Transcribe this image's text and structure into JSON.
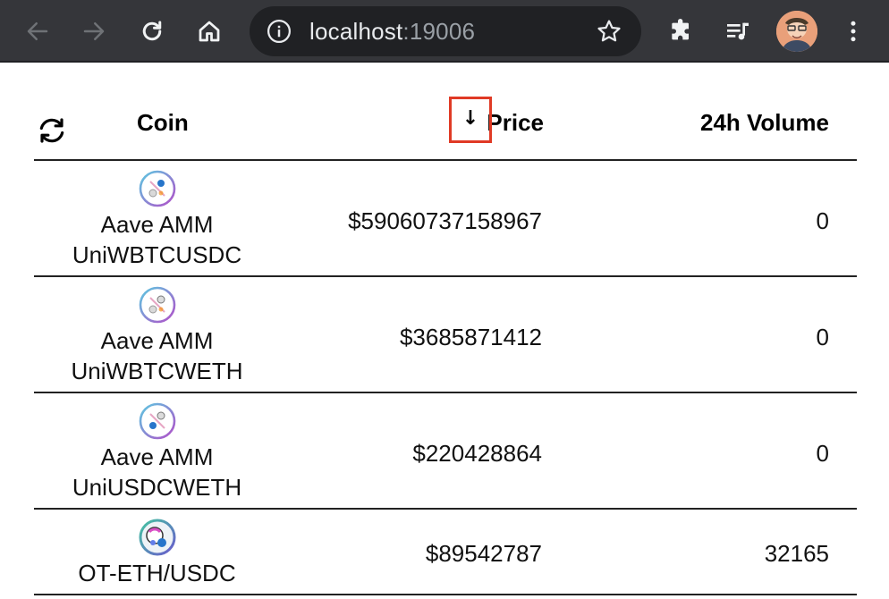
{
  "browser": {
    "url_host": "localhost",
    "url_port": ":19006",
    "icons": [
      "back-arrow-icon",
      "forward-arrow-icon",
      "reload-icon",
      "home-icon",
      "info-icon",
      "star-icon",
      "extensions-icon",
      "media-queue-icon",
      "profile-avatar",
      "more-vert-icon"
    ]
  },
  "table": {
    "headers": {
      "coin": "Coin",
      "price": "Price",
      "volume": "24h Volume",
      "sort_indicator": "↓"
    },
    "rows": [
      {
        "name": "Aave AMM UniWBTCUSDC",
        "price": "$59060737158967",
        "volume": "0"
      },
      {
        "name": "Aave AMM UniWBTCWETH",
        "price": "$3685871412",
        "volume": "0"
      },
      {
        "name": "Aave AMM UniUSDCWETH",
        "price": "$220428864",
        "volume": "0"
      },
      {
        "name": "OT-ETH/USDC",
        "price": "$89542787",
        "volume": "32165"
      }
    ]
  },
  "colors": {
    "chrome_bg": "#35363a",
    "omnibox_bg": "#202124",
    "highlight_box": "#e03a25"
  }
}
